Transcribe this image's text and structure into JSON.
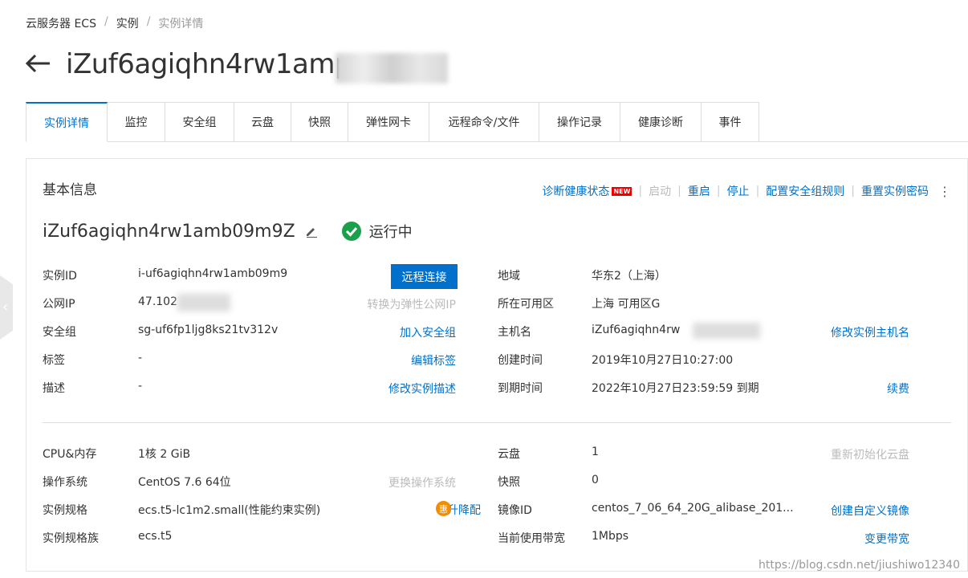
{
  "breadcrumb": {
    "item1": "云服务器 ECS",
    "item2": "实例",
    "item3": "实例详情",
    "sep": "/"
  },
  "header": {
    "title": "iZuf6agiqhn4rw1amр"
  },
  "tabs": [
    "实例详情",
    "监控",
    "安全组",
    "云盘",
    "快照",
    "弹性网卡",
    "远程命令/文件",
    "操作记录",
    "健康诊断",
    "事件"
  ],
  "panel": {
    "title": "基本信息",
    "actions": {
      "diagnose": "诊断健康状态",
      "new_badge": "NEW",
      "start": "启动",
      "restart": "重启",
      "stop": "停止",
      "config_sg": "配置安全组规则",
      "reset_pwd": "重置实例密码"
    },
    "instance_name": "iZuf6agiqhn4rw1amb09m9Z",
    "status": "运行中"
  },
  "left": {
    "id_label": "实例ID",
    "id_value": "i-uf6agiqhn4rw1amb09m9",
    "remote_btn": "远程连接",
    "ip_label": "公网IP",
    "ip_value": "47.102",
    "ip_action": "转换为弹性公网IP",
    "sg_label": "安全组",
    "sg_value": "sg-uf6fp1ljg8ks21tv312v",
    "sg_action": "加入安全组",
    "tag_label": "标签",
    "tag_value": "-",
    "tag_action": "编辑标签",
    "desc_label": "描述",
    "desc_value": "-",
    "desc_action": "修改实例描述"
  },
  "right": {
    "region_label": "地域",
    "region_value": "华东2（上海）",
    "zone_label": "所在可用区",
    "zone_value": "上海 可用区G",
    "host_label": "主机名",
    "host_value": "iZuf6agiqhn4rw",
    "host_action": "修改实例主机名",
    "created_label": "创建时间",
    "created_value": "2019年10月27日10:27:00",
    "expire_label": "到期时间",
    "expire_value": "2022年10月27日23:59:59 到期",
    "expire_action": "续费"
  },
  "config": {
    "cpu_label": "CPU&内存",
    "cpu_value": "1核 2 GiB",
    "os_label": "操作系统",
    "os_value": "CentOS 7.6 64位",
    "os_action": "更换操作系统",
    "spec_label": "实例规格",
    "spec_value": "ecs.t5-lc1m2.small(性能约束实例)",
    "spec_action": "升降配",
    "spec_badge": "惠",
    "family_label": "实例规格族",
    "family_value": "ecs.t5",
    "disk_label": "云盘",
    "disk_value": "1",
    "disk_action": "重新初始化云盘",
    "snap_label": "快照",
    "snap_value": "0",
    "image_label": "镜像ID",
    "image_value": "centos_7_06_64_20G_alibase_201...",
    "image_action": "创建自定义镜像",
    "bw_label": "当前使用带宽",
    "bw_value": "1Mbps",
    "bw_action": "变更带宽"
  },
  "watermark": "https://blog.csdn.net/jiushiwo12340",
  "colors": {
    "accent": "#0070cc",
    "success": "#1aa04a",
    "badge": "#e00000",
    "promo": "#f28c00"
  }
}
